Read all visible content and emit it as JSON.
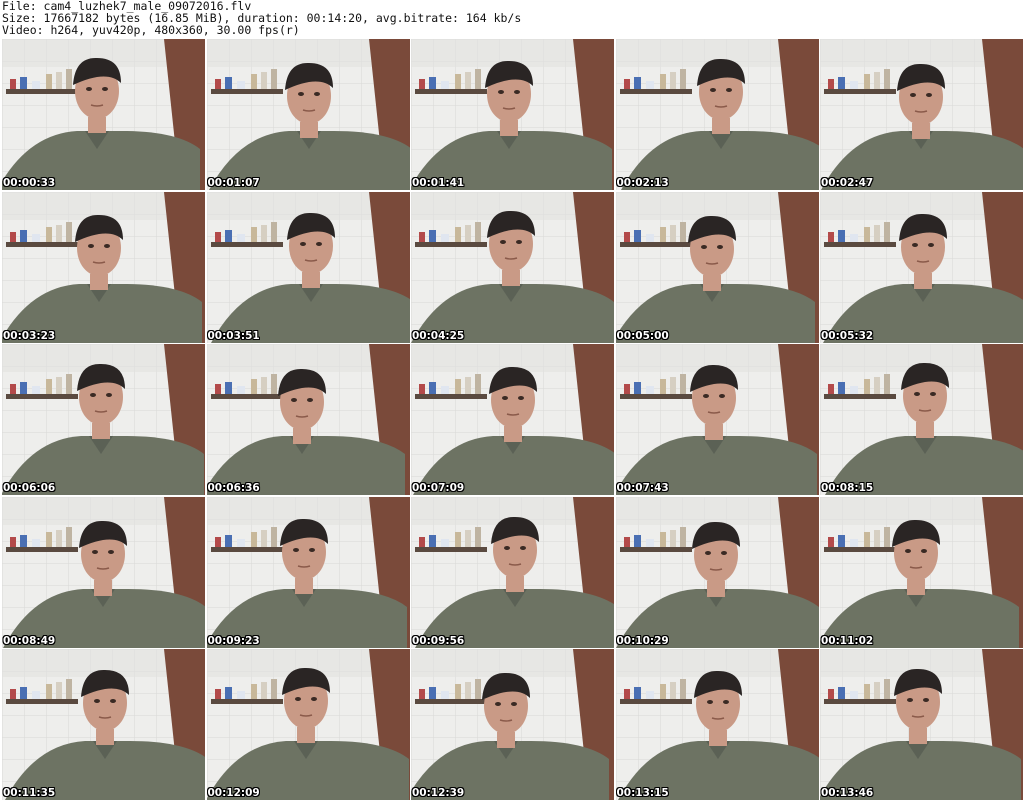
{
  "header": {
    "file_line": "File: cam4_luzhek7_male_09072016.flv",
    "size_line": "Size: 17667182 bytes (16.85 MiB), duration: 00:14:20, avg.bitrate: 164 kb/s",
    "video_line": "Video: h264, yuv420p, 480x360, 30.00 fps(r)"
  },
  "thumbnails": [
    {
      "time": "00:00:33"
    },
    {
      "time": "00:01:07"
    },
    {
      "time": "00:01:41"
    },
    {
      "time": "00:02:13"
    },
    {
      "time": "00:02:47"
    },
    {
      "time": "00:03:23"
    },
    {
      "time": "00:03:51"
    },
    {
      "time": "00:04:25"
    },
    {
      "time": "00:05:00"
    },
    {
      "time": "00:05:32"
    },
    {
      "time": "00:06:06"
    },
    {
      "time": "00:06:36"
    },
    {
      "time": "00:07:09"
    },
    {
      "time": "00:07:43"
    },
    {
      "time": "00:08:15"
    },
    {
      "time": "00:08:49"
    },
    {
      "time": "00:09:23"
    },
    {
      "time": "00:09:56"
    },
    {
      "time": "00:10:29"
    },
    {
      "time": "00:11:02"
    },
    {
      "time": "00:11:35"
    },
    {
      "time": "00:12:09"
    },
    {
      "time": "00:12:39"
    },
    {
      "time": "00:13:15"
    },
    {
      "time": "00:13:46"
    }
  ],
  "colors": {
    "wall": "#eeeeec",
    "door": "#7a4a3a",
    "shelf": "#5a4a40",
    "shirt": "#6d7363",
    "skin": "#c99a86",
    "hair": "#2a2524"
  }
}
